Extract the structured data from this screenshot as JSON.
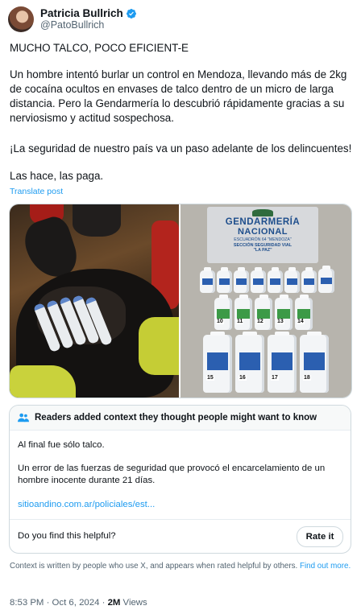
{
  "author": {
    "display_name": "Patricia Bullrich",
    "handle": "@PatoBullrich",
    "verified_icon": "verified-badge-icon"
  },
  "tweet": {
    "title": "MUCHO TALCO, POCO EFICIENT-E",
    "paragraph1": "Un hombre intentó burlar un control en Mendoza, llevando más de 2kg de cocaína ocultos en envases de talco dentro de un micro de larga distancia. Pero la Gendarmería lo descubrió rápidamente gracias a su nerviosismo y actitud sospechosa.",
    "paragraph2": "¡La seguridad de nuestro país va un paso adelante de los delincuentes!",
    "paragraph3": "Las hace, las paga.",
    "translate": "Translate post"
  },
  "media": {
    "sign_line1": "GENDARMERÍA",
    "sign_line2": "NACIONAL",
    "sign_line3": "ESCUADRÓN 64 \"MENDOZA\"",
    "sign_line4": "SECCIÓN SEGURIDAD VIAL",
    "sign_line5": "\"LA PAZ\"",
    "bottle_numbers_row2": [
      "10",
      "11",
      "12",
      "13",
      "14"
    ],
    "bottle_numbers_row3": [
      "15",
      "16",
      "17",
      "18"
    ]
  },
  "community_note": {
    "header": "Readers added context they thought people might want to know",
    "body1": "Al final fue sólo talco.",
    "body2": "Un error de las fuerzas de seguridad que provocó el encarcelamiento de un hombre inocente durante 21 días.",
    "link": "sitioandino.com.ar/policiales/est...",
    "question": "Do you find this helpful?",
    "rate_button": "Rate it"
  },
  "footnote": {
    "text": "Context is written by people who use X, and appears when rated helpful by others.",
    "link": "Find out more."
  },
  "meta": {
    "timestamp": "8:53 PM · Oct 6, 2024 · ",
    "views_count": "2M",
    "views_label": " Views"
  },
  "colors": {
    "accent": "#1d9bf0",
    "verified": "#1d9bf0",
    "text": "#0f1419",
    "secondary": "#536471"
  }
}
